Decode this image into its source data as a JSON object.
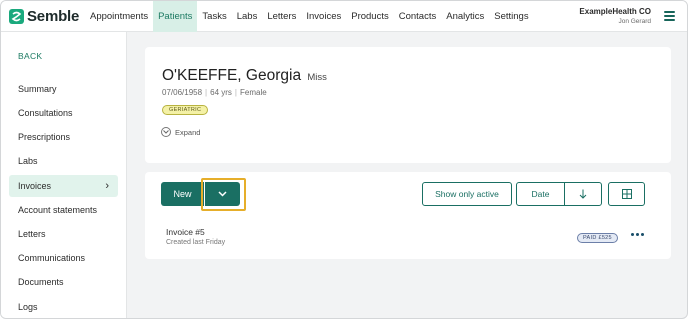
{
  "app": {
    "name": "Semble",
    "brand_color": "#1aa97d",
    "accent": "#1a6f63"
  },
  "nav": [
    "Appointments",
    "Patients",
    "Tasks",
    "Labs",
    "Letters",
    "Invoices",
    "Products",
    "Contacts",
    "Analytics",
    "Settings"
  ],
  "nav_active": "Patients",
  "org": {
    "name": "ExampleHealth CO",
    "user": "Jon Gerard"
  },
  "sidebar": {
    "back": "BACK",
    "items": [
      "Summary",
      "Consultations",
      "Prescriptions",
      "Labs",
      "Invoices",
      "Account statements",
      "Letters",
      "Communications",
      "Documents",
      "Logs"
    ],
    "active": "Invoices"
  },
  "patient": {
    "name": "O'KEEFFE, Georgia",
    "title": "Miss",
    "dob": "07/06/1958",
    "age": "64 yrs",
    "sex": "Female",
    "badge": "GERIATRIC",
    "expand": "Expand"
  },
  "toolbar": {
    "new_label": "New",
    "show_active": "Show only active",
    "date": "Date"
  },
  "invoice": {
    "title": "Invoice #5",
    "subtitle": "Created last Friday",
    "status": "PAID £525"
  }
}
